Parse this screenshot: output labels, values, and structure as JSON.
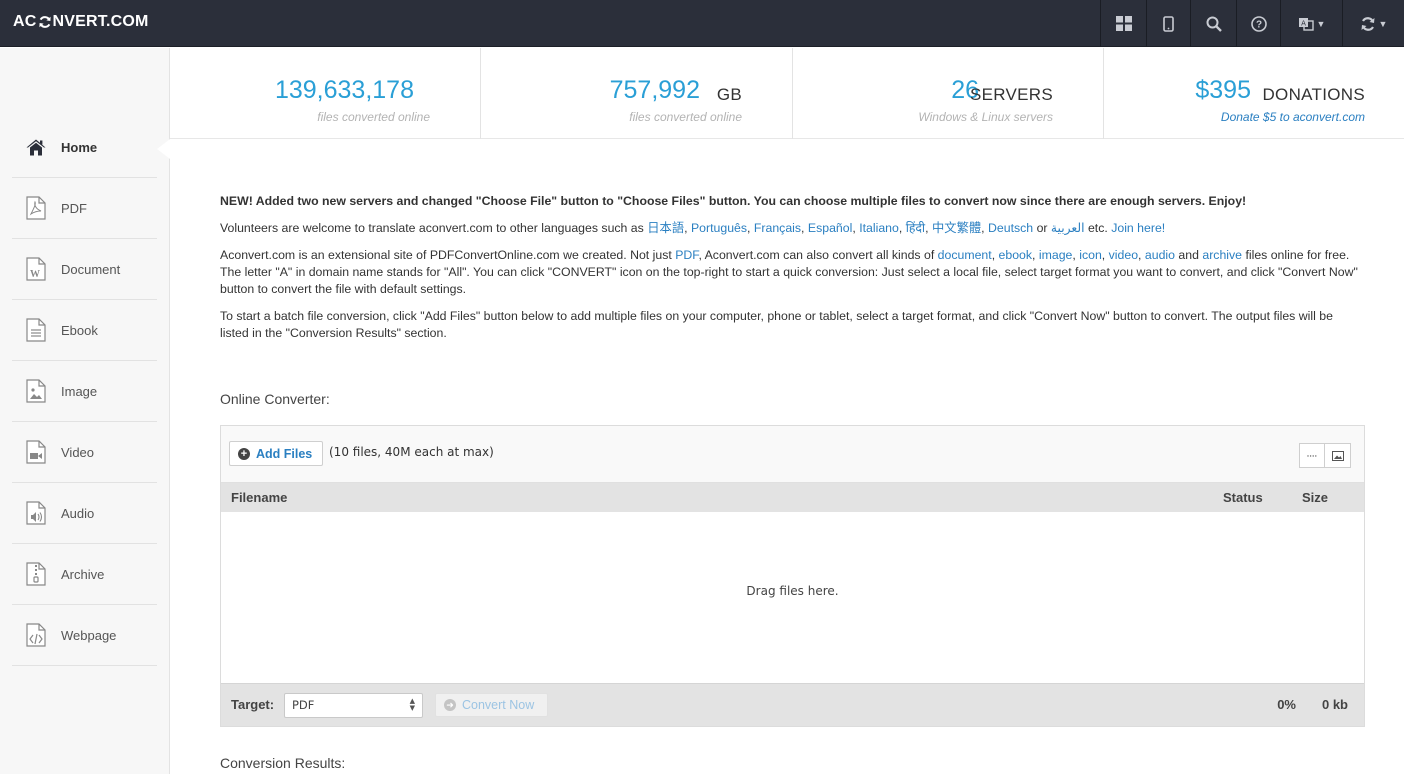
{
  "header": {
    "logo_left": "AC",
    "logo_right": "NVERT.COM",
    "icons": [
      "grid-icon",
      "mobile-icon",
      "search-icon",
      "help-icon",
      "language-icon",
      "convert-refresh-icon"
    ]
  },
  "sidebar": {
    "items": [
      {
        "label": "Home",
        "icon": "home-icon"
      },
      {
        "label": "PDF",
        "icon": "pdf-file-icon"
      },
      {
        "label": "Document",
        "icon": "document-file-icon"
      },
      {
        "label": "Ebook",
        "icon": "ebook-file-icon"
      },
      {
        "label": "Image",
        "icon": "image-file-icon"
      },
      {
        "label": "Video",
        "icon": "video-file-icon"
      },
      {
        "label": "Audio",
        "icon": "audio-file-icon"
      },
      {
        "label": "Archive",
        "icon": "archive-file-icon"
      },
      {
        "label": "Webpage",
        "icon": "webpage-file-icon"
      }
    ]
  },
  "stats": [
    {
      "number": "139,633,178",
      "unit": "",
      "sub": "files converted online"
    },
    {
      "number": "757,992",
      "unit": "GB",
      "sub": "files converted online"
    },
    {
      "number": "26",
      "unit": "SERVERS",
      "sub": "Windows & Linux servers"
    },
    {
      "number": "$395",
      "unit": "DONATIONS",
      "sub": "Donate $5 to aconvert.com"
    }
  ],
  "content": {
    "news": "NEW! Added two new servers and changed \"Choose File\" button to \"Choose Files\" button. You can choose multiple files to convert now since there are enough servers. Enjoy!",
    "volunteers_prefix": "Volunteers are welcome to translate aconvert.com to other languages such as",
    "languages": [
      "日本語",
      "Português",
      "Français",
      "Español",
      "Italiano",
      "हिंदी",
      "中文繁體",
      "Deutsch"
    ],
    "or_text": "or",
    "arabic": "العربية",
    "etc_text": "etc.",
    "join_link": "Join here!",
    "p3_a": "Aconvert.com is an extensional site of PDFConvertOnline.com we created. Not just",
    "p3_pdf": "PDF",
    "p3_b": ", Aconvert.com can also convert all kinds of",
    "p3_document": "document",
    "p3_ebook": "ebook",
    "p3_image": "image",
    "p3_icon": "icon",
    "p3_video": "video",
    "p3_audio": "audio",
    "p3_and": "and",
    "p3_archive": "archive",
    "p3_c": "files online for free. The letter \"A\" in domain name stands for \"All\". You can click \"CONVERT\" icon on the top-right to start a quick conversion: Just select a local file, select target format you want to convert, and click \"Convert Now\" button to convert the file with default settings.",
    "p4": "To start a batch file conversion, click \"Add Files\" button below to add multiple files on your computer, phone or tablet, select a target format, and click \"Convert Now\" button to convert. The output files will be listed in the \"Conversion Results\" section."
  },
  "converter": {
    "title": "Online Converter:",
    "add_files": "Add Files",
    "limit": "(10 files, 40M each at max)",
    "columns": {
      "filename": "Filename",
      "status": "Status",
      "size": "Size"
    },
    "drop_hint": "Drag files here.",
    "target_label": "Target:",
    "target_value": "PDF",
    "convert_now": "Convert Now",
    "progress": "0%",
    "total_size": "0 kb"
  },
  "results": {
    "title": "Conversion Results:"
  }
}
